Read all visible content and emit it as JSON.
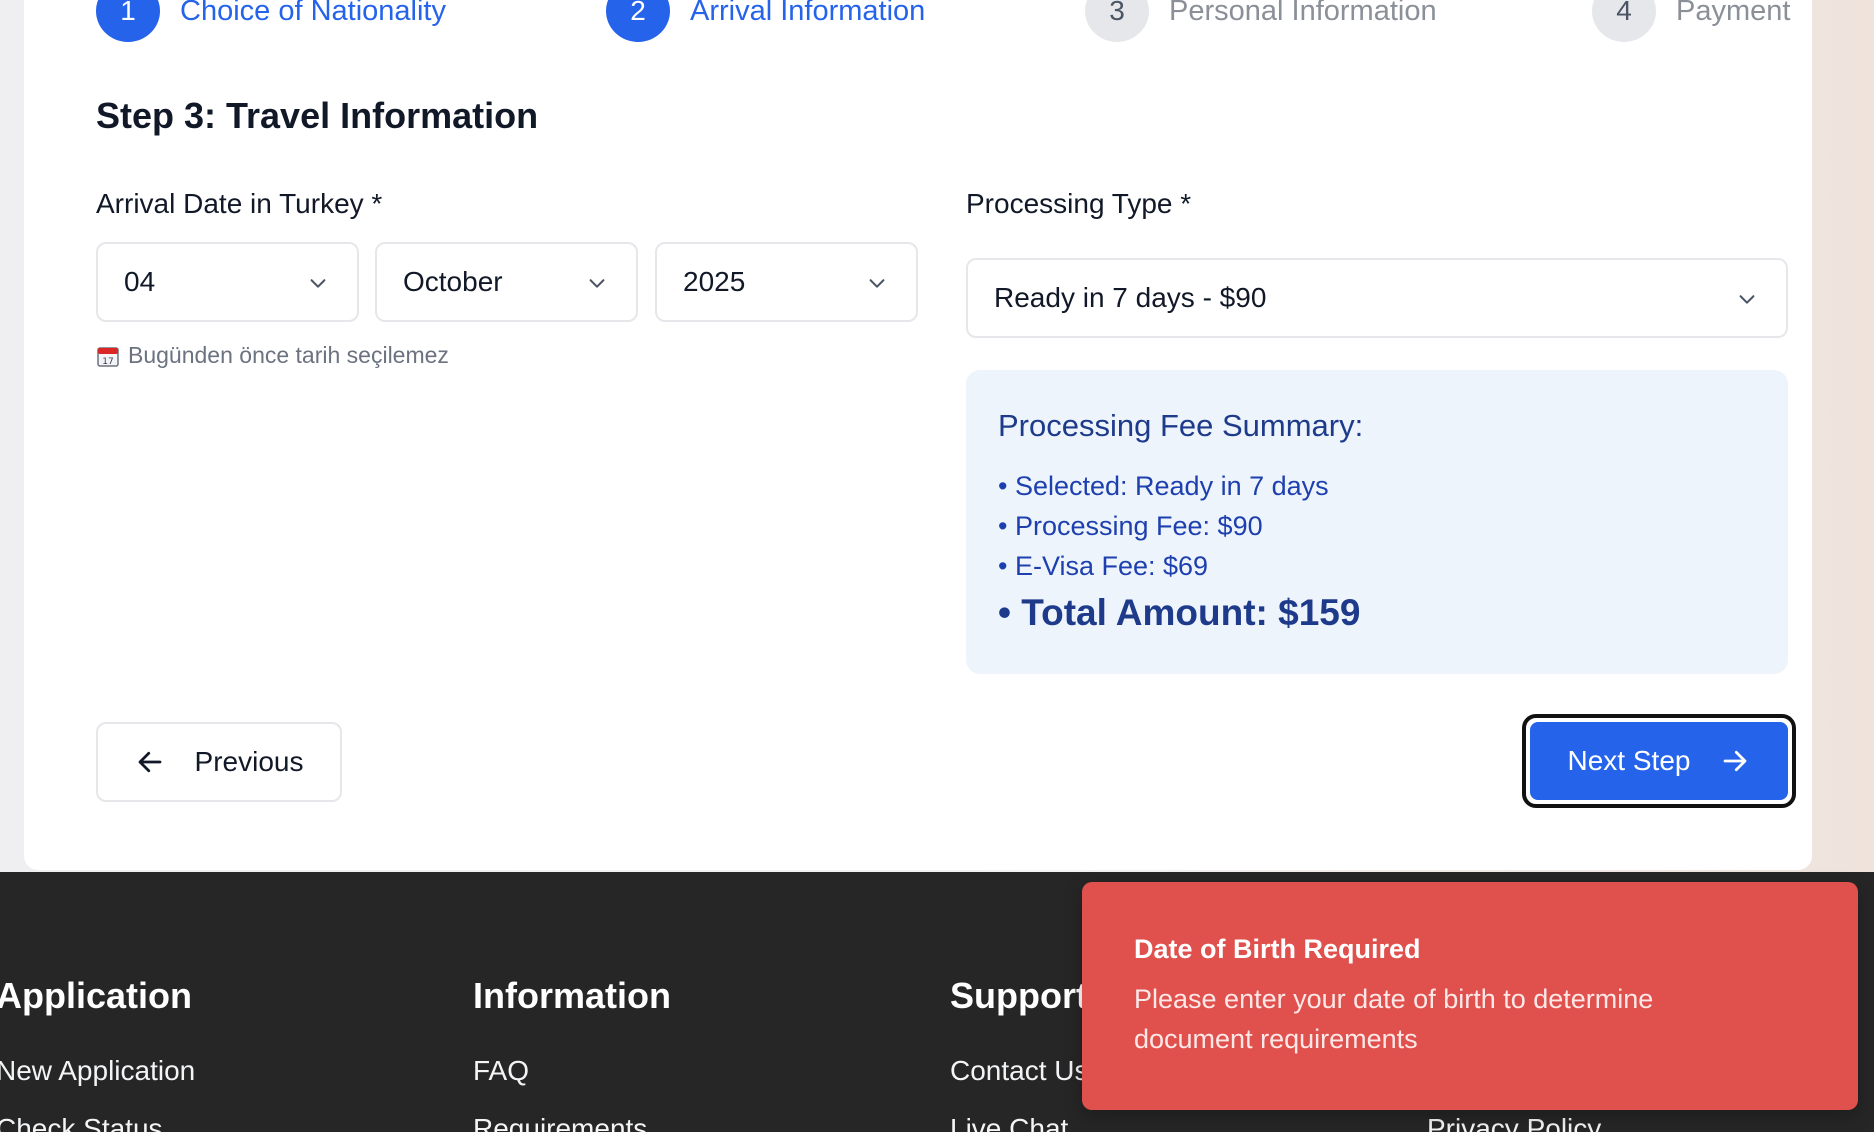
{
  "stepper": [
    {
      "num": "1",
      "label": "Choice of Nationality",
      "state": "active"
    },
    {
      "num": "2",
      "label": "Arrival Information",
      "state": "active"
    },
    {
      "num": "3",
      "label": "Personal Information",
      "state": "inactive"
    },
    {
      "num": "4",
      "label": "Payment",
      "state": "inactive"
    }
  ],
  "form": {
    "title": "Step 3: Travel Information",
    "arrival_label": "Arrival Date in Turkey *",
    "day": "04",
    "month": "October",
    "year": "2025",
    "hint_icon": "calendar-icon",
    "hint": "Bugünden önce tarih seçilemez",
    "processing_label": "Processing Type *",
    "processing_value": "Ready in 7 days - $90"
  },
  "summary": {
    "heading": "Processing Fee Summary:",
    "lines": [
      "• Selected: Ready in 7 days",
      "• Processing Fee: $90",
      "• E-Visa Fee: $69"
    ],
    "total": "• Total Amount: $159"
  },
  "nav": {
    "previous": "Previous",
    "next": "Next Step"
  },
  "footer": {
    "columns": [
      {
        "heading": "Application",
        "links": [
          "New Application",
          "Check Status"
        ]
      },
      {
        "heading": "Information",
        "links": [
          "FAQ",
          "Requirements"
        ]
      },
      {
        "heading": "Support",
        "links": [
          "Contact Us",
          "Live Chat"
        ]
      },
      {
        "heading": "",
        "links": [
          "",
          "Privacy Policy"
        ]
      }
    ]
  },
  "toast": {
    "title": "Date of Birth Required",
    "body": "Please enter your date of birth to determine document requirements"
  },
  "colors": {
    "primary": "#2563eb",
    "toast": "#e0514d",
    "footer": "#262626",
    "summary_bg": "#eef4fc"
  }
}
